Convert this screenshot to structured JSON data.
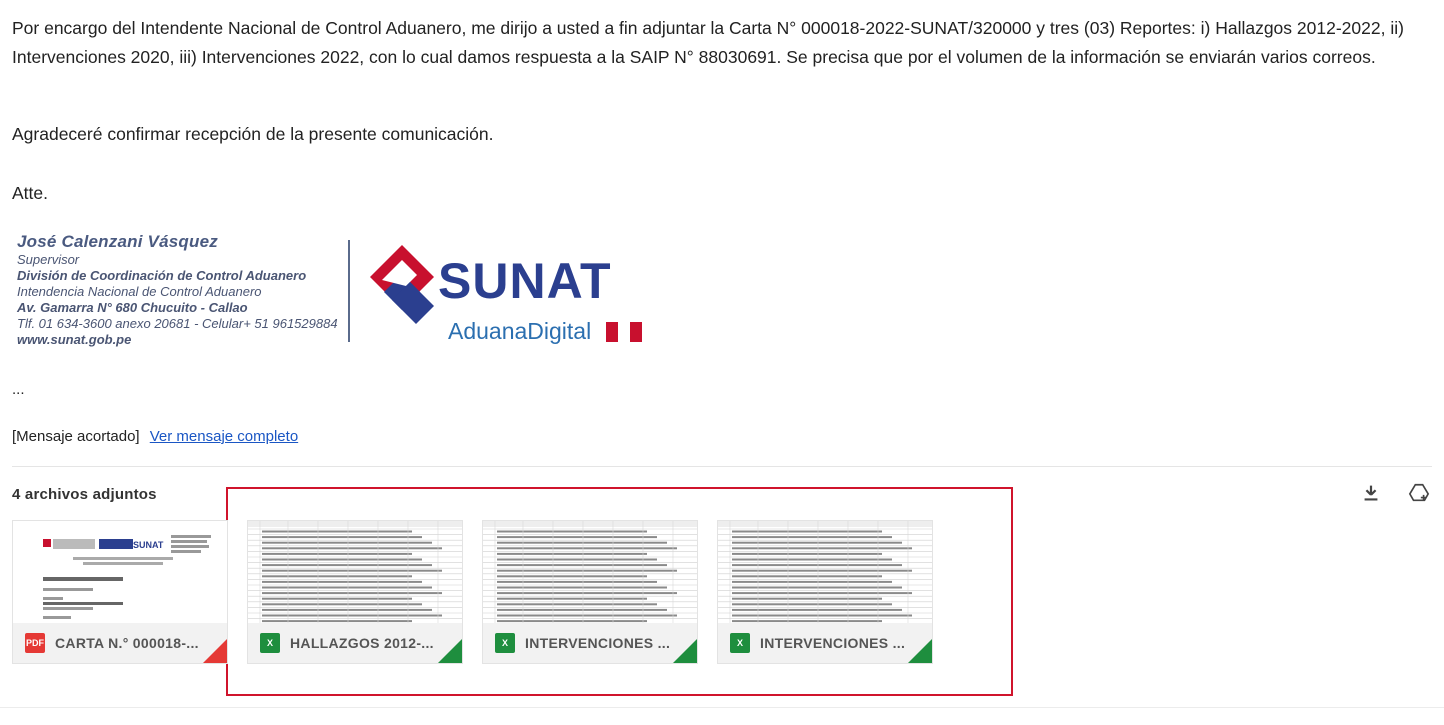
{
  "email": {
    "paragraph_intro": "Por encargo del Intendente Nacional de Control Aduanero, me dirijo a usted a fin adjuntar la Carta N° 000018-2022-SUNAT/320000 y tres (03) Reportes: i) Hallazgos 2012-2022, ii) Intervenciones 2020, iii) Intervenciones 2022, con lo cual damos respuesta a la SAIP N° 88030691. Se precisa que por el volumen de la información se enviarán varios correos.",
    "paragraph_confirm": "Agradeceré confirmar recepción de la presente comunicación.",
    "closing": "Atte.",
    "ellipsis": "...",
    "trimmed_label": "[Mensaje acortado]",
    "view_full_link": "Ver mensaje completo"
  },
  "signature": {
    "name": "José Calenzani Vásquez",
    "role": "Supervisor",
    "division": "División de Coordinación de Control Aduanero",
    "intendencia": "Intendencia Nacional de Control Aduanero",
    "address": "Av. Gamarra N° 680 Chucuito - Callao",
    "phone": "Tlf. 01 634-3600 anexo 20681 - Celular+ 51 961529884",
    "website": "www.sunat.gob.pe"
  },
  "logo": {
    "brand": "SUNAT",
    "subtitle": "AduanaDigital",
    "brand_color": "#2b3f8f",
    "accent_color": "#c8102e"
  },
  "attachments": {
    "title": "4 archivos adjuntos",
    "download_all_icon": "download-icon",
    "save_to_drive_icon": "add-to-drive-icon",
    "items": [
      {
        "type": "PDF",
        "name": "CARTA N.° 000018-...",
        "icon": "pdf-icon",
        "color": "#e53935"
      },
      {
        "type": "X",
        "name": "HALLAZGOS 2012-...",
        "icon": "excel-icon",
        "color": "#1e8e3e"
      },
      {
        "type": "X",
        "name": "INTERVENCIONES ...",
        "icon": "excel-icon",
        "color": "#1e8e3e"
      },
      {
        "type": "X",
        "name": "INTERVENCIONES ...",
        "icon": "excel-icon",
        "color": "#1e8e3e"
      }
    ]
  }
}
